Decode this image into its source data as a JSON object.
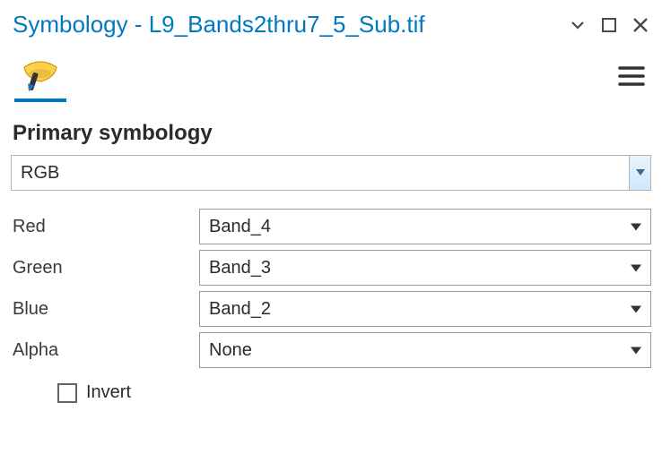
{
  "title": "Symbology - L9_Bands2thru7_5_Sub.tif",
  "section_heading": "Primary symbology",
  "method": {
    "value": "RGB"
  },
  "bands": {
    "red": {
      "label": "Red",
      "value": "Band_4"
    },
    "green": {
      "label": "Green",
      "value": "Band_3"
    },
    "blue": {
      "label": "Blue",
      "value": "Band_2"
    },
    "alpha": {
      "label": "Alpha",
      "value": "None"
    }
  },
  "invert": {
    "label": "Invert",
    "checked": false
  }
}
